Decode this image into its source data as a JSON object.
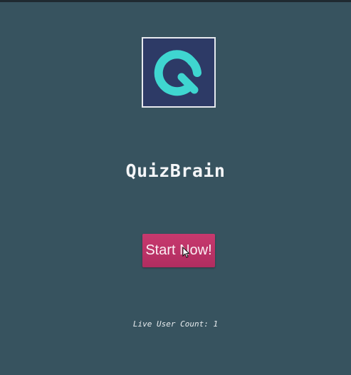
{
  "app": {
    "logo_icon": "quizbrain-q-logo-icon",
    "title": "QuizBrain"
  },
  "actions": {
    "start_label": "Start Now!"
  },
  "status": {
    "live_user_label": "Live User Count:",
    "live_user_count": "1"
  },
  "colors": {
    "background": "#37535f",
    "logo_background": "#2d3a66",
    "logo_accent": "#3fd6d0",
    "button": "#bd3468"
  },
  "cursor_icon": "mouse-pointer-icon"
}
